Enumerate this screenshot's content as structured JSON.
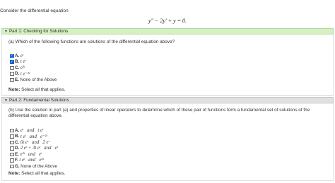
{
  "intro": "Consider the differential equation",
  "equation": "y″ − 2y′ + y = 0.",
  "part1": {
    "title": "Part 1: Checking for Solutions",
    "question": "(a) Which of the following functions are solutions of the differential equation above?",
    "options": [
      {
        "letter": "A.",
        "expr": "eᵗ",
        "checked": true
      },
      {
        "letter": "B.",
        "expr": "t eᵗ",
        "checked": true
      },
      {
        "letter": "C.",
        "expr": "e²ᵗ",
        "checked": false
      },
      {
        "letter": "D.",
        "expr": "t e⁻²ᵗ",
        "checked": false
      },
      {
        "letter": "E.",
        "expr": "None of the Above",
        "checked": false
      }
    ],
    "note_label": "Note:",
    "note_text": "Select all that applies."
  },
  "part2": {
    "title": "Part 2: Fundamental Solutions",
    "question": "(b) Use the solution in part (a) and properties of linear operators to determine which of these pair of functions form a fundamental set of solutions of the differential equation above.",
    "options": [
      {
        "letter": "A.",
        "expr": "eᵗ   and   t eᵗ",
        "checked": false
      },
      {
        "letter": "B.",
        "expr": "t eᵗ   and   e⁻²ᵗ",
        "checked": false
      },
      {
        "letter": "C.",
        "expr": "6t eᵗ   and   2 eᵗ",
        "checked": false
      },
      {
        "letter": "D.",
        "expr": "2 eᵗ + 3t eᵗ   and   eᵗ",
        "checked": false
      },
      {
        "letter": "E.",
        "expr": "e²ᵗ   and   eᵗ",
        "checked": false
      },
      {
        "letter": "F.",
        "expr": "t eᵗ   and   e²ᵗ",
        "checked": false
      },
      {
        "letter": "G.",
        "expr": "None of the Above",
        "checked": false
      }
    ],
    "note_label": "Note:",
    "note_text": "Select all that applies."
  }
}
